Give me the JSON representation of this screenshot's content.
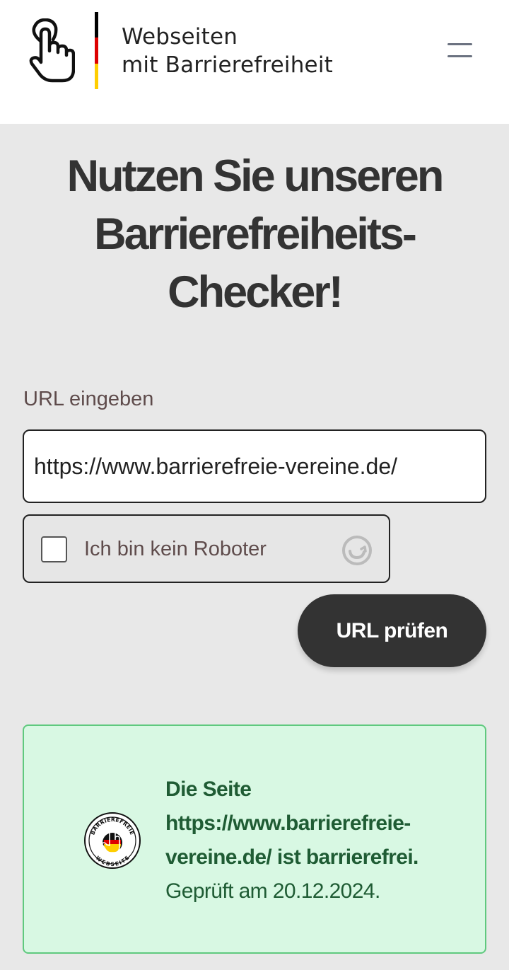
{
  "header": {
    "brand_line1": "Webseiten",
    "brand_line2": "mit Barrierefreiheit",
    "logo_icon": "touch-hand-icon",
    "menu_icon": "hamburger-menu-icon",
    "flag_colors": [
      "#000000",
      "#dd0000",
      "#ffce00"
    ]
  },
  "hero": {
    "title": "Nutzen Sie unseren Barrierefreiheits-Checker!",
    "title_lines": [
      "Nutzen Sie unseren",
      "Barrierefreiheits-",
      "Checker!"
    ]
  },
  "form": {
    "url_label": "URL eingeben",
    "url_value": "https://www.barrierefreie-vereine.de/",
    "captcha_label": "Ich bin kein Roboter",
    "captcha_checked": false,
    "captcha_icon": "captcha-refresh-icon",
    "submit_label": "URL prüfen"
  },
  "result": {
    "line1": "Die Seite",
    "line2": "https://www.barrierefreie-",
    "line3": "vereine.de/ ist barrierefrei.",
    "checked_date": "Geprüft am 20.12.2024.",
    "badge_top": "BARRIEREFREIE",
    "badge_bottom": "WEBSEITE",
    "badge_icon": "accessibility-badge-icon",
    "colors": {
      "background": "#d8f8e3",
      "border": "#5fc97e",
      "text": "#1f5c34"
    }
  }
}
